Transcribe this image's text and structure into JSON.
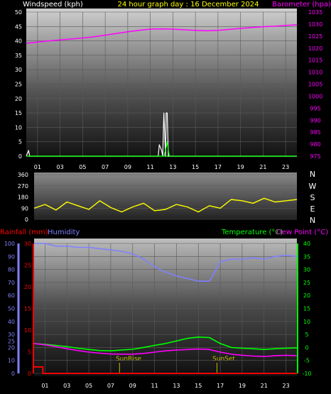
{
  "header": {
    "left_label": "Windspeed (kph)",
    "center_title": "24 hour graph day : 16 December 2024",
    "right_label": "Barometer (hpa)"
  },
  "direction_panel": {
    "compass_labels": [
      "N",
      "W",
      "S",
      "E",
      "N"
    ]
  },
  "lower_header": {
    "rainfall_label": "Rainfall (mm)",
    "humidity_label": "Humidity",
    "temperature_label": "Temperature (°C)",
    "dewpoint_label": "Dew Point (°C)"
  },
  "annotations": {
    "sunrise": "SunRise",
    "sunset": "SunSet"
  },
  "colors": {
    "windspeed_axis": "#ffffff",
    "wind_gust": "#ffffff",
    "wind_avg": "#00ff00",
    "barometer": "#ff00ff",
    "direction": "#ffff00",
    "rainfall": "#ff0000",
    "humidity": "#8080ff",
    "temperature": "#00ff00",
    "dewpoint": "#ff00ff",
    "title": "#ffff00",
    "sun_marker": "#c0c000",
    "grid": "#5a5a5a"
  },
  "chart_data": [
    {
      "type": "line",
      "title": "24 hour graph day : 16 December 2024",
      "x_ticks": [
        "01",
        "03",
        "05",
        "07",
        "09",
        "11",
        "13",
        "15",
        "17",
        "19",
        "21",
        "23"
      ],
      "xlim": [
        0,
        24
      ],
      "left_axis": {
        "label": "Windspeed (kph)",
        "ylim": [
          0,
          50
        ],
        "ticks": [
          0,
          5,
          10,
          15,
          20,
          25,
          30,
          35,
          40,
          45,
          50
        ]
      },
      "right_axis": {
        "label": "Barometer (hpa)",
        "ylim": [
          975,
          1035
        ],
        "ticks": [
          975,
          980,
          985,
          990,
          995,
          1000,
          1005,
          1010,
          1015,
          1020,
          1025,
          1030,
          1035
        ]
      },
      "grid": true,
      "series": [
        {
          "name": "Barometer (hpa)",
          "axis": "right",
          "x": [
            0,
            1,
            2,
            3,
            4,
            5,
            6,
            7,
            8,
            9,
            10,
            11,
            12,
            13,
            14,
            15,
            16,
            17,
            18,
            19,
            20,
            21,
            22,
            23,
            24
          ],
          "values": [
            1022.0,
            1022.5,
            1023.0,
            1023.4,
            1023.8,
            1024.2,
            1024.7,
            1025.4,
            1026.1,
            1026.8,
            1027.4,
            1027.9,
            1028.0,
            1027.9,
            1027.6,
            1027.4,
            1027.2,
            1027.4,
            1027.8,
            1028.2,
            1028.6,
            1028.9,
            1029.1,
            1029.4,
            1029.7
          ]
        },
        {
          "axis": "left",
          "x": [
            0,
            0.2,
            0.3,
            0.5,
            11.7,
            11.8,
            12.0,
            12.1,
            12.2,
            12.35,
            12.4,
            12.5,
            12.6,
            12.7,
            12.8,
            24
          ],
          "values": [
            0,
            2,
            0,
            0,
            0,
            4,
            2,
            0,
            15,
            0,
            15,
            15,
            0,
            0,
            0,
            0
          ]
        },
        {
          "axis": "left",
          "x": [
            0,
            12.2,
            12.4,
            12.5,
            12.6,
            12.7,
            24
          ],
          "values": [
            0,
            0,
            3,
            5,
            2,
            0,
            0
          ]
        }
      ]
    },
    {
      "type": "line",
      "x_ticks": [
        "01",
        "03",
        "05",
        "07",
        "09",
        "11",
        "13",
        "15",
        "17",
        "19",
        "21",
        "23"
      ],
      "xlim": [
        0,
        24
      ],
      "ylim": [
        0,
        360
      ],
      "y_ticks": [
        0,
        90,
        180,
        270,
        360
      ],
      "compass_labels": [
        "N",
        "W",
        "S",
        "E",
        "N"
      ],
      "series": [
        {
          "axis": "left",
          "x": [
            0,
            1,
            2,
            3,
            4,
            5,
            6,
            7,
            8,
            9,
            10,
            11,
            12,
            13,
            14,
            15,
            16,
            17,
            18,
            19,
            20,
            21,
            22,
            23,
            24
          ],
          "values": [
            90,
            120,
            75,
            140,
            110,
            80,
            150,
            95,
            60,
            100,
            130,
            70,
            80,
            120,
            100,
            60,
            110,
            90,
            160,
            150,
            130,
            170,
            140,
            150,
            160
          ]
        }
      ]
    },
    {
      "type": "line",
      "x_ticks": [
        "01",
        "03",
        "05",
        "07",
        "09",
        "11",
        "13",
        "15",
        "17",
        "19",
        "21",
        "23"
      ],
      "xlim": [
        0,
        24
      ],
      "left_axis_humidity": {
        "label": "Humidity",
        "ylim": [
          0,
          100
        ],
        "ticks": [
          0,
          10,
          20,
          25,
          30,
          40,
          50,
          60,
          70,
          80,
          90,
          100
        ]
      },
      "left_axis_rainfall": {
        "label": "Rainfall (mm)",
        "ylim": [
          0,
          30
        ],
        "ticks": [
          0,
          5,
          10,
          15,
          20,
          25,
          30
        ]
      },
      "right_axis": {
        "label": "Temperature (°C)",
        "ylim": [
          -10,
          40
        ],
        "ticks": [
          -10,
          -5,
          0,
          5,
          10,
          15,
          20,
          25,
          30,
          35,
          40
        ]
      },
      "annotations": [
        {
          "text": "SunRise",
          "x": 7.8
        },
        {
          "text": "SunSet",
          "x": 16.7
        }
      ],
      "grid": true,
      "series": [
        {
          "name": "Humidity",
          "axis": "humidity",
          "x": [
            0,
            1,
            2,
            3,
            4,
            5,
            6,
            7,
            8,
            9,
            10,
            11,
            12,
            13,
            14,
            15,
            16,
            16.5,
            17,
            18,
            19,
            20,
            21,
            22,
            23,
            24
          ],
          "values": [
            100,
            100,
            98,
            98,
            97,
            97,
            96,
            95,
            94,
            92,
            88,
            82,
            78,
            75,
            73,
            71,
            71,
            78,
            86,
            88,
            88,
            89,
            88,
            90,
            91,
            90
          ]
        },
        {
          "name": "Rainfall (mm)",
          "axis": "rainfall",
          "x": [
            0,
            0.8,
            0.8,
            24
          ],
          "values": [
            1.5,
            1.5,
            0,
            0
          ]
        },
        {
          "name": "Temperature (°C)",
          "axis": "temperature",
          "x": [
            0,
            1,
            2,
            3,
            4,
            5,
            6,
            7,
            8,
            9,
            10,
            11,
            12,
            13,
            14,
            15,
            16,
            17,
            18,
            19,
            20,
            21,
            22,
            23,
            24
          ],
          "values": [
            1.5,
            1.2,
            0.8,
            0.3,
            -0.3,
            -0.8,
            -1.2,
            -1.3,
            -1.0,
            -0.7,
            0.0,
            0.8,
            1.5,
            2.5,
            3.5,
            4.0,
            3.8,
            1.5,
            0.0,
            -0.3,
            -0.5,
            -0.8,
            -0.5,
            -0.3,
            -0.2
          ]
        },
        {
          "name": "Dew Point (°C)",
          "axis": "temperature",
          "x": [
            0,
            1,
            2,
            3,
            4,
            5,
            6,
            7,
            8,
            9,
            10,
            11,
            12,
            13,
            14,
            15,
            16,
            17,
            18,
            19,
            20,
            21,
            22,
            23,
            24
          ],
          "values": [
            1.5,
            1.0,
            0.3,
            -0.5,
            -1.2,
            -1.8,
            -2.2,
            -2.5,
            -2.6,
            -2.6,
            -2.3,
            -1.8,
            -1.3,
            -1.0,
            -0.8,
            -0.6,
            -0.8,
            -1.8,
            -2.6,
            -3.0,
            -3.3,
            -3.5,
            -3.2,
            -3.0,
            -3.2
          ]
        }
      ]
    }
  ]
}
